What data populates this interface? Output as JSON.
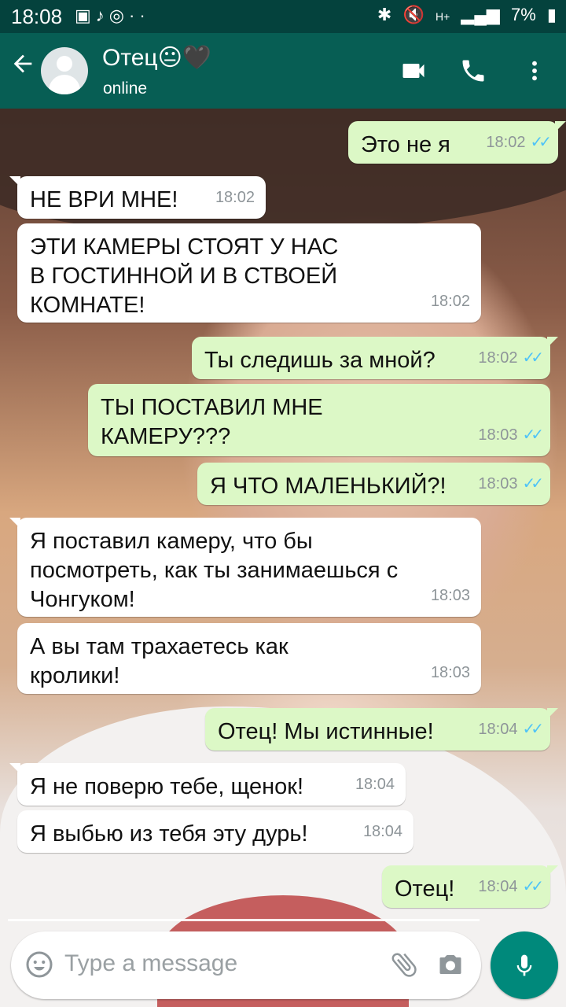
{
  "status_bar": {
    "time": "18:08",
    "notification_icons": [
      "image-icon",
      "music-icon",
      "whatsapp-icon",
      "more-dots"
    ],
    "battery": "7%",
    "signal_label": "H+"
  },
  "header": {
    "contact_name": "Отец😐🖤",
    "status": "online",
    "colors": {
      "bar": "#075e54",
      "status_bar": "#04423d"
    }
  },
  "messages": [
    {
      "dir": "out",
      "text": "Это не я",
      "time": "18:02",
      "read": true
    },
    {
      "dir": "in",
      "text": "НЕ ВРИ МНЕ!",
      "time": "18:02"
    },
    {
      "dir": "in",
      "text": "ЭТИ КАМЕРЫ СТОЯТ У НАС\nВ ГОСТИННОЙ И В СТВОЕЙ\nКОМНАТЕ!",
      "time": "18:02"
    },
    {
      "dir": "out",
      "text": "Ты следишь за мной?",
      "time": "18:02",
      "read": true
    },
    {
      "dir": "out",
      "text": "ТЫ ПОСТАВИЛ МНЕ\nКАМЕРУ???",
      "time": "18:03",
      "read": true
    },
    {
      "dir": "out",
      "text": "Я ЧТО МАЛЕНЬКИЙ?!",
      "time": "18:03",
      "read": true
    },
    {
      "dir": "in",
      "text": "Я поставил камеру, что бы\nпосмотреть, как ты занимаешься с\nЧонгуком!",
      "time": "18:03"
    },
    {
      "dir": "in",
      "text": "А вы там трахаетесь как\nкролики!",
      "time": "18:03"
    },
    {
      "dir": "out",
      "text": "Отец! Мы истинные!",
      "time": "18:04",
      "read": true
    },
    {
      "dir": "in",
      "text": "Я не поверю тебе, щенок!",
      "time": "18:04"
    },
    {
      "dir": "in",
      "text": "Я выбью из тебя эту дурь!",
      "time": "18:04"
    },
    {
      "dir": "out",
      "text": "Отец!",
      "time": "18:04",
      "read": true
    }
  ],
  "composer": {
    "placeholder": "Type a message",
    "mic_color": "#00897b"
  }
}
